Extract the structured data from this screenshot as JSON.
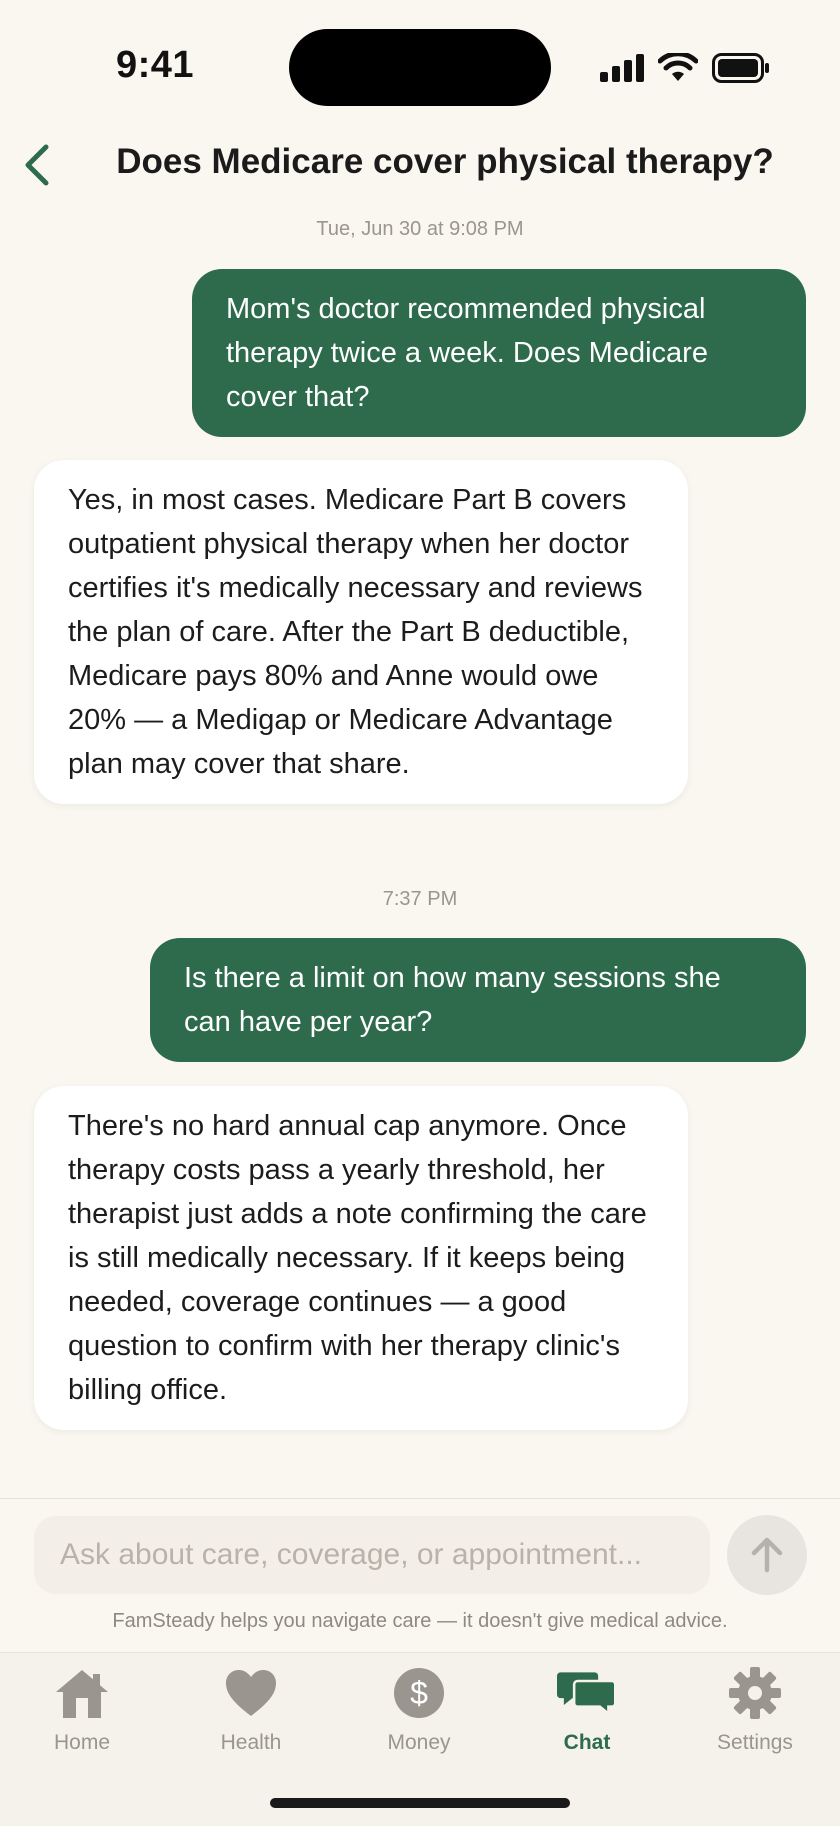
{
  "status_bar": {
    "time": "9:41"
  },
  "header": {
    "title": "Does Medicare cover physical therapy?"
  },
  "chat": {
    "messages": [
      {
        "type": "timestamp",
        "text": "Tue, Jun 30 at 9:08 PM"
      },
      {
        "type": "user",
        "text": "Mom's doctor recommended physical therapy twice a week. Does Medicare cover that?"
      },
      {
        "type": "assistant",
        "text": "Yes, in most cases. Medicare Part B covers outpatient physical therapy when her doctor certifies it's medically necessary and reviews the plan of care. After the Part B deductible, Medicare pays 80% and Anne would owe 20% — a Medigap or Medicare Advantage plan may cover that share."
      },
      {
        "type": "timestamp",
        "text": "7:37 PM"
      },
      {
        "type": "user",
        "text": "Is there a limit on how many sessions she can have per year?"
      },
      {
        "type": "assistant",
        "text": "There's no hard annual cap anymore. Once therapy costs pass a yearly threshold, her therapist just adds a note confirming the care is still medically necessary. If it keeps being needed, coverage continues — a good question to confirm with her therapy clinic's billing office."
      }
    ]
  },
  "composer": {
    "placeholder": "Ask about care, coverage, or appointment...",
    "value": "",
    "send_icon": "arrow-up-icon"
  },
  "disclaimer": "FamSteady helps you navigate care — it doesn't give medical advice.",
  "tabs": [
    {
      "label": "Home",
      "icon": "home-icon",
      "active": false
    },
    {
      "label": "Health",
      "icon": "heart-icon",
      "active": false
    },
    {
      "label": "Money",
      "icon": "dollar-icon",
      "active": false
    },
    {
      "label": "Chat",
      "icon": "chat-bubbles-icon",
      "active": true
    },
    {
      "label": "Settings",
      "icon": "gear-icon",
      "active": false
    }
  ],
  "colors": {
    "accent": "#2E6B4C",
    "background": "#FAF7F1",
    "inactive": "#9A958E"
  }
}
